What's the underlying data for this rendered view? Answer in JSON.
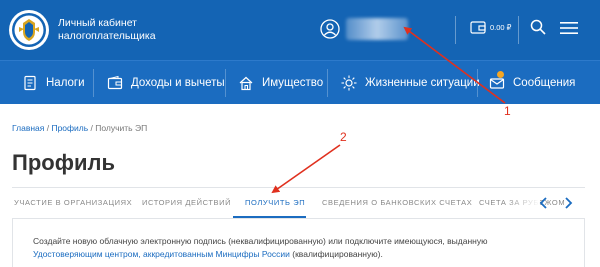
{
  "header": {
    "brand_line1": "Личный кабинет",
    "brand_line2": "налогоплательщика",
    "balance": "0.00 ₽"
  },
  "nav": {
    "items": [
      {
        "label": "Налоги",
        "icon": "document-icon"
      },
      {
        "label": "Доходы и вычеты",
        "icon": "wallet-icon"
      },
      {
        "label": "Имущество",
        "icon": "house-icon"
      },
      {
        "label": "Жизненные ситуации",
        "icon": "sun-icon"
      },
      {
        "label": "Сообщения",
        "icon": "envelope-icon"
      }
    ]
  },
  "breadcrumb": {
    "home": "Главная",
    "sep1": " / ",
    "profile": "Профиль",
    "sep2": " / ",
    "current": "Получить ЭП"
  },
  "page": {
    "title": "Профиль"
  },
  "tabs": [
    {
      "label": "УЧАСТИЕ В ОРГАНИЗАЦИЯХ",
      "active": false
    },
    {
      "label": "ИСТОРИЯ ДЕЙСТВИЙ",
      "active": false
    },
    {
      "label": "ПОЛУЧИТЬ ЭП",
      "active": true
    },
    {
      "label": "СВЕДЕНИЯ О БАНКОВСКИХ СЧЕТАХ",
      "active": false
    },
    {
      "label": "СЧЕТА ЗА РУБЕЖОМ",
      "active": false
    }
  ],
  "content": {
    "text_before": "Создайте новую облачную электронную подпись (неквалифицированную) или подключите имеющуюся, выданную ",
    "link_text": "Удостоверяющим центром, аккредитованным Минцифры России",
    "text_after": " (квалифицированную)."
  },
  "annotations": [
    {
      "number": "1"
    },
    {
      "number": "2"
    }
  ],
  "colors": {
    "header_bg": "#1464b4",
    "nav_bg": "#1b6cc0",
    "accent": "#1b6cc0",
    "annotation": "#e0301e",
    "badge": "#f5a623"
  }
}
